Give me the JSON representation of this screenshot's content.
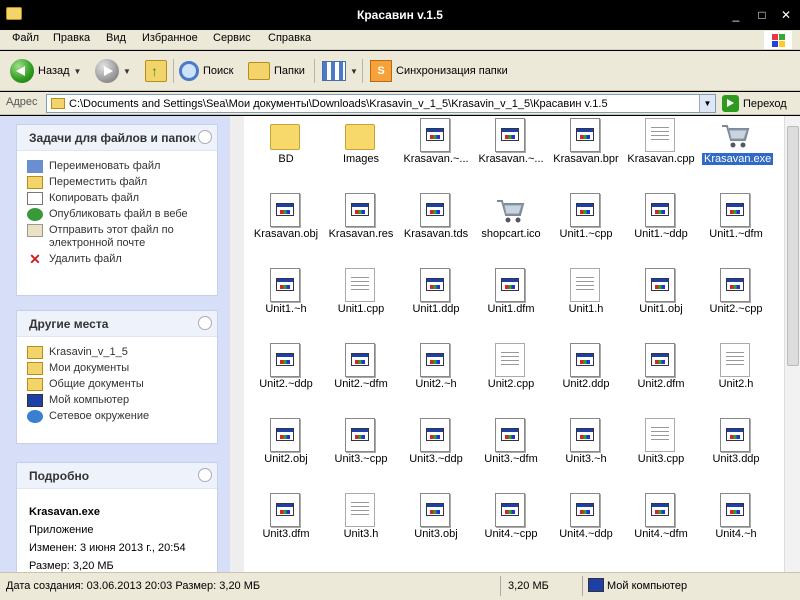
{
  "window": {
    "title": "Красавин v.1.5"
  },
  "menu": [
    "Файл",
    "Правка",
    "Вид",
    "Избранное",
    "Сервис",
    "Справка"
  ],
  "toolbar": {
    "back": "Назад",
    "search": "Поиск",
    "folders": "Папки",
    "sync": "Синхронизация папки"
  },
  "address": {
    "label": "Адрес",
    "path": "C:\\Documents and Settings\\Sea\\Мои документы\\Downloads\\Krasavin_v_1_5\\Krasavin_v_1_5\\Красавин v.1.5",
    "go": "Переход"
  },
  "tasks": {
    "title": "Задачи для файлов и папок",
    "items": [
      "Переименовать файл",
      "Переместить файл",
      "Копировать файл",
      "Опубликовать файл в вебе",
      "Отправить этот файл по электронной почте",
      "Удалить файл"
    ]
  },
  "places": {
    "title": "Другие места",
    "items": [
      "Krasavin_v_1_5",
      "Мои документы",
      "Общие документы",
      "Мой компьютер",
      "Сетевое окружение"
    ]
  },
  "details": {
    "title": "Подробно",
    "name": "Krasavan.exe",
    "type": "Приложение",
    "modified": "Изменен: 3 июня 2013 г., 20:54",
    "size": "Размер: 3,20 МБ"
  },
  "files": [
    {
      "name": "BD",
      "icon": "folder"
    },
    {
      "name": "Images",
      "icon": "folder"
    },
    {
      "name": "Krasavan.~...",
      "icon": "doc"
    },
    {
      "name": "Krasavan.~...",
      "icon": "doc"
    },
    {
      "name": "Krasavan.bpr",
      "icon": "doc"
    },
    {
      "name": "Krasavan.cpp",
      "icon": "text"
    },
    {
      "name": "Krasavan.exe",
      "icon": "cart",
      "selected": true
    },
    {
      "name": "Krasavan.obj",
      "icon": "doc"
    },
    {
      "name": "Krasavan.res",
      "icon": "doc"
    },
    {
      "name": "Krasavan.tds",
      "icon": "doc"
    },
    {
      "name": "shopcart.ico",
      "icon": "cart"
    },
    {
      "name": "Unit1.~cpp",
      "icon": "doc"
    },
    {
      "name": "Unit1.~ddp",
      "icon": "doc"
    },
    {
      "name": "Unit1.~dfm",
      "icon": "doc"
    },
    {
      "name": "Unit1.~h",
      "icon": "doc"
    },
    {
      "name": "Unit1.cpp",
      "icon": "text"
    },
    {
      "name": "Unit1.ddp",
      "icon": "doc"
    },
    {
      "name": "Unit1.dfm",
      "icon": "doc"
    },
    {
      "name": "Unit1.h",
      "icon": "text"
    },
    {
      "name": "Unit1.obj",
      "icon": "doc"
    },
    {
      "name": "Unit2.~cpp",
      "icon": "doc"
    },
    {
      "name": "Unit2.~ddp",
      "icon": "doc"
    },
    {
      "name": "Unit2.~dfm",
      "icon": "doc"
    },
    {
      "name": "Unit2.~h",
      "icon": "doc"
    },
    {
      "name": "Unit2.cpp",
      "icon": "text"
    },
    {
      "name": "Unit2.ddp",
      "icon": "doc"
    },
    {
      "name": "Unit2.dfm",
      "icon": "doc"
    },
    {
      "name": "Unit2.h",
      "icon": "text"
    },
    {
      "name": "Unit2.obj",
      "icon": "doc"
    },
    {
      "name": "Unit3.~cpp",
      "icon": "doc"
    },
    {
      "name": "Unit3.~ddp",
      "icon": "doc"
    },
    {
      "name": "Unit3.~dfm",
      "icon": "doc"
    },
    {
      "name": "Unit3.~h",
      "icon": "doc"
    },
    {
      "name": "Unit3.cpp",
      "icon": "text"
    },
    {
      "name": "Unit3.ddp",
      "icon": "doc"
    },
    {
      "name": "Unit3.dfm",
      "icon": "doc"
    },
    {
      "name": "Unit3.h",
      "icon": "text"
    },
    {
      "name": "Unit3.obj",
      "icon": "doc"
    },
    {
      "name": "Unit4.~cpp",
      "icon": "doc"
    },
    {
      "name": "Unit4.~ddp",
      "icon": "doc"
    },
    {
      "name": "Unit4.~dfm",
      "icon": "doc"
    },
    {
      "name": "Unit4.~h",
      "icon": "doc"
    }
  ],
  "status": {
    "left": "Дата создания: 03.06.2013 20:03 Размер: 3,20 МБ",
    "size": "3,20 МБ",
    "zone": "Мой компьютер"
  }
}
